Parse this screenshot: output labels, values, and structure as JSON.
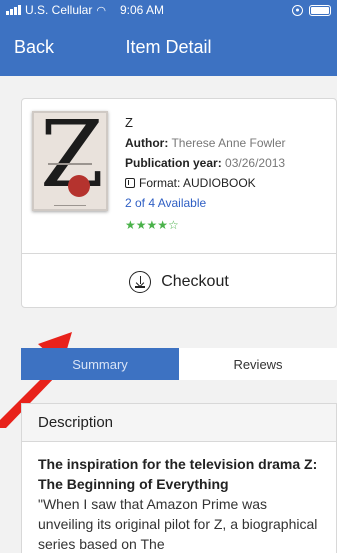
{
  "status_bar": {
    "carrier": "U.S. Cellular",
    "time": "9:06 AM"
  },
  "nav": {
    "back_label": "Back",
    "title": "Item Detail"
  },
  "item": {
    "title": "Z",
    "author_label": "Author:",
    "author": "Therese Anne Fowler",
    "pub_label": "Publication year:",
    "pub_date": "03/26/2013",
    "format": "Format: AUDIOBOOK",
    "availability": "2 of 4 Available",
    "rating": 4,
    "rating_max": 5,
    "rating_glyphs": "★★★★☆"
  },
  "checkout_label": "Checkout",
  "tabs": [
    {
      "label": "Summary",
      "active": true
    },
    {
      "label": "Reviews",
      "active": false
    }
  ],
  "description": {
    "header": "Description",
    "headline": "The inspiration for the television drama Z: The Beginning of Everything",
    "text": "\"When I saw that Amazon Prime was unveiling its original pilot for Z, a biographical series based on The"
  },
  "colors": {
    "primary": "#3d72c2",
    "link": "#2f5fc4",
    "stars": "#4ab24a",
    "arrow": "#e8221b"
  },
  "icons": {
    "format": "audiobook-icon",
    "checkout": "download-circle-icon"
  }
}
